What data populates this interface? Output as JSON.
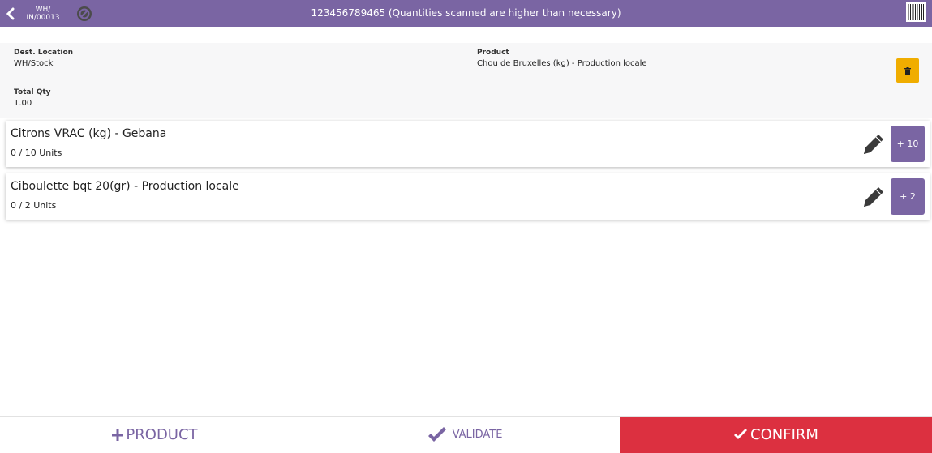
{
  "header": {
    "doc_ref_line1": "WH/",
    "doc_ref_line2": "IN/00013",
    "title": "123456789465 (Quantities scanned are higher than necessary)"
  },
  "info": {
    "dest_location_label": "Dest. Location",
    "dest_location_value": "WH/Stock",
    "product_label": "Product",
    "product_value": "Chou de Bruxelles (kg) - Production locale",
    "total_qty_label": "Total Qty",
    "total_qty_value": "1.00"
  },
  "lines": [
    {
      "name": "Citrons VRAC (kg) - Gebana",
      "qty": "0 / 10 Units",
      "increment": "+ 10"
    },
    {
      "name": "Ciboulette bqt 20(gr) - Production locale",
      "qty": "0 / 2 Units",
      "increment": "+ 2"
    }
  ],
  "actions": {
    "product": "PRODUCT",
    "validate": "VALIDATE",
    "confirm": "CONFIRM"
  },
  "colors": {
    "primary": "#7a65a3",
    "warning": "#f0ad00",
    "danger": "#dc3040"
  },
  "icons": [
    "back-arrow-icon",
    "cancel-icon",
    "barcode-icon",
    "trash-icon",
    "pencil-icon",
    "plus-icon",
    "check-icon"
  ]
}
